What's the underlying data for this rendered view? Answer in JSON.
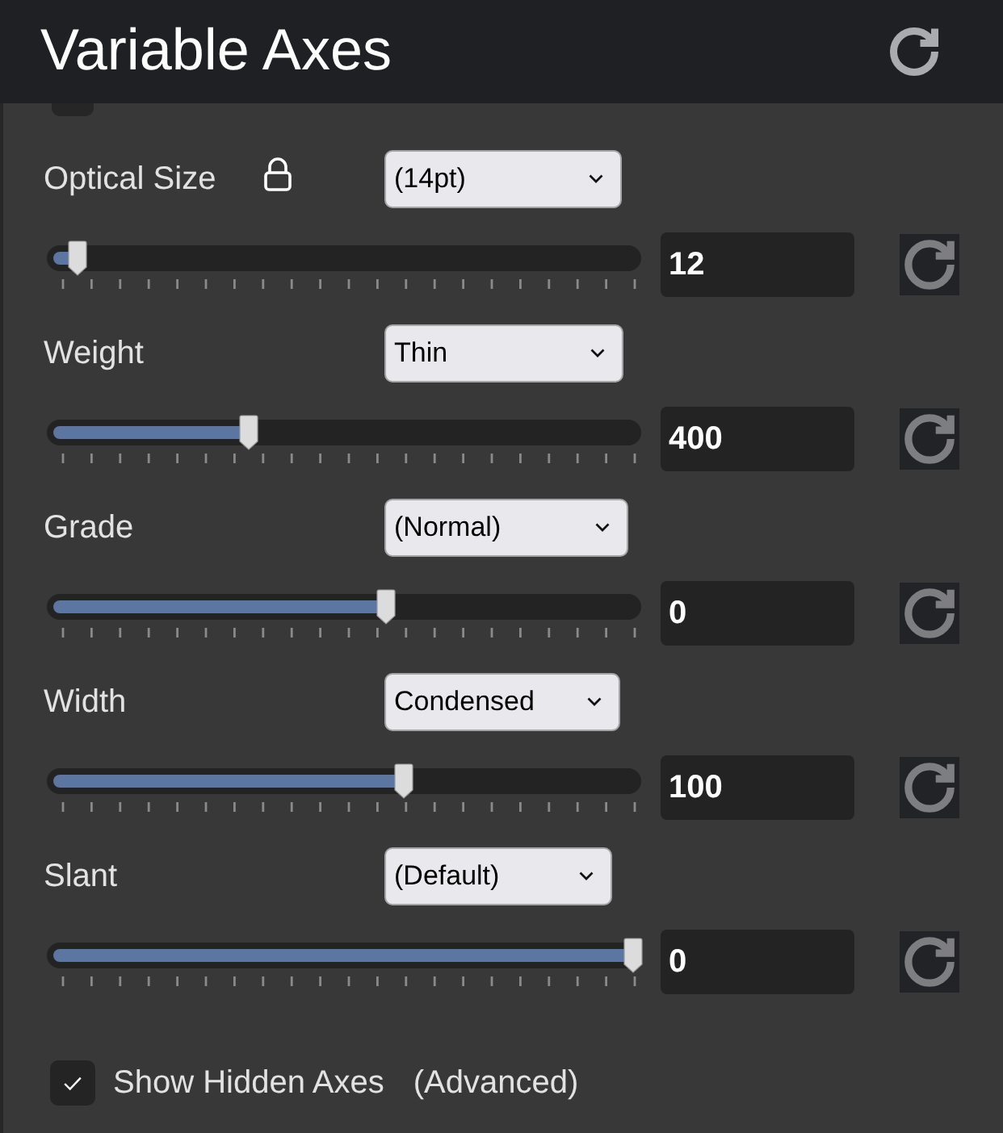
{
  "panel": {
    "title": "Variable Axes"
  },
  "axes": [
    {
      "label": "Optical Size",
      "locked": true,
      "preset": "(14pt)",
      "level": 0.03,
      "value": "12"
    },
    {
      "label": "Weight",
      "locked": false,
      "preset": "Thin",
      "level": 0.33,
      "value": "400"
    },
    {
      "label": "Grade",
      "locked": false,
      "preset": "(Normal)",
      "level": 0.57,
      "value": "0"
    },
    {
      "label": "Width",
      "locked": false,
      "preset": "Condensed",
      "level": 0.6,
      "value": "100"
    },
    {
      "label": "Slant",
      "locked": false,
      "preset": "(Default)",
      "level": 1,
      "value": "0"
    }
  ],
  "show_hidden_axes": {
    "checked": true,
    "label": "Show Hidden Axes",
    "note": "(Advanced)"
  }
}
